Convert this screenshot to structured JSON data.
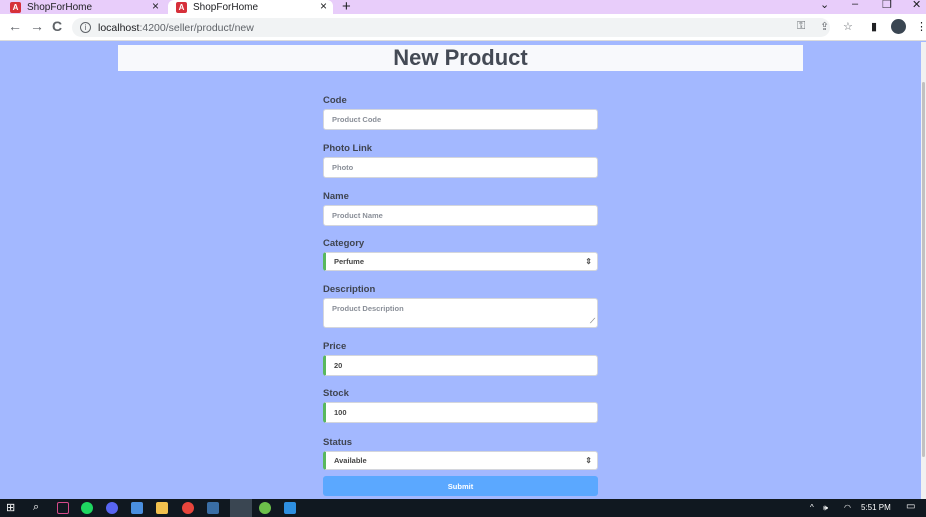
{
  "browser": {
    "tabs": [
      {
        "label": "ShopForHome",
        "favicon": "angular-icon",
        "active": false
      },
      {
        "label": "ShopForHome",
        "favicon": "angular-icon",
        "active": true
      }
    ],
    "favicon_glyph": "A",
    "new_tab_glyph": "+",
    "close_glyph": "×",
    "window_controls": {
      "minimize": "–",
      "maximize": "❐",
      "close": "✕",
      "dropdown": "⌄"
    },
    "nav": {
      "back": "←",
      "forward": "→",
      "reload": "C"
    },
    "url_host": "localhost",
    "url_path": ":4200/seller/product/new",
    "info_glyph": "i",
    "toolbar_icons": {
      "key": "⚿",
      "share": "⇪",
      "star": "☆",
      "sidepanel": "▮",
      "menu": "⋮"
    }
  },
  "page": {
    "title": "New Product",
    "fields": [
      {
        "label": "Code",
        "placeholder": "Product Code",
        "value": "",
        "type": "input",
        "valid": false
      },
      {
        "label": "Photo Link",
        "placeholder": "Photo",
        "value": "",
        "type": "input",
        "valid": false
      },
      {
        "label": "Name",
        "placeholder": "Product Name",
        "value": "",
        "type": "input",
        "valid": false
      },
      {
        "label": "Category",
        "placeholder": "",
        "value": "Perfume",
        "type": "select",
        "valid": true
      },
      {
        "label": "Description",
        "placeholder": "Product Description",
        "value": "",
        "type": "textarea",
        "valid": false
      },
      {
        "label": "Price",
        "placeholder": "",
        "value": "20",
        "type": "input",
        "valid": true
      },
      {
        "label": "Stock",
        "placeholder": "",
        "value": "100",
        "type": "input",
        "valid": true
      },
      {
        "label": "Status",
        "placeholder": "",
        "value": "Available",
        "type": "select",
        "valid": true
      }
    ],
    "submit_label": "Submit",
    "select_caret": "⇕",
    "resize_glyph": "⟋"
  },
  "taskbar": {
    "start_glyph": "⊞",
    "search_glyph": "⌕",
    "tray_arrow": "^",
    "tray_volume": "🕪",
    "tray_wifi": "◠",
    "time": "5:51 PM",
    "notification_glyph": "▭"
  },
  "colors": {
    "page_bg": "#a3b8ff",
    "valid_accent": "#59b85d",
    "submit_bg": "#5ba8ff",
    "tab_strip": "#e8cdfa"
  }
}
